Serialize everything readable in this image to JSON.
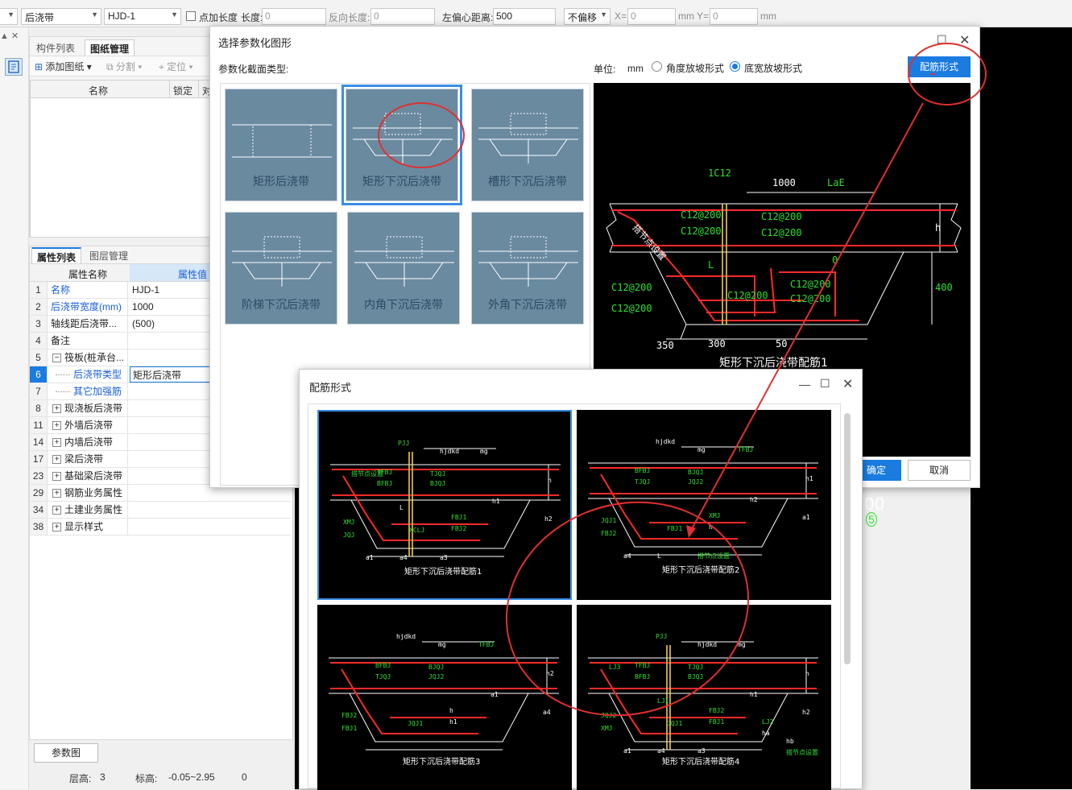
{
  "toolbar": {
    "combo1": "后浇带",
    "combo2": "HJD-1",
    "dot_length_label": "点加长度",
    "length_label": "长度:",
    "length_value": "0",
    "reverse_label": "反向长度:",
    "reverse_value": "0",
    "offset_label": "左偏心距离:",
    "offset_value": "500",
    "move_option": "不偏移",
    "x_label": "X=",
    "x_value": "0",
    "unit1": "mm",
    "y_label": "Y=",
    "y_value": "0",
    "unit2": "mm"
  },
  "left_panel": {
    "tabs": [
      "构件列表",
      "图纸管理"
    ],
    "tools": [
      "添加图纸",
      "分割",
      "定位"
    ],
    "columns": [
      "名称",
      "锁定",
      "对"
    ]
  },
  "prop_panel": {
    "tabs": [
      "属性列表",
      "图层管理"
    ],
    "headers": [
      "属性名称",
      "属性值"
    ],
    "rows": [
      {
        "num": "1",
        "name": "名称",
        "value": "HJD-1",
        "blue": true,
        "expand": false
      },
      {
        "num": "2",
        "name": "后浇带宽度(mm)",
        "value": "1000",
        "blue": true,
        "expand": false
      },
      {
        "num": "3",
        "name": "轴线距后浇带...",
        "value": "(500)",
        "blue": false,
        "expand": false
      },
      {
        "num": "4",
        "name": "备注",
        "value": "",
        "blue": false,
        "expand": false
      },
      {
        "num": "5",
        "name": "筏板(桩承台...",
        "value": "",
        "blue": false,
        "expand": true,
        "minus": true
      },
      {
        "num": "6",
        "name": "后浇带类型",
        "value": "矩形后浇带",
        "blue": true,
        "expand": false,
        "indent": true,
        "selected": true
      },
      {
        "num": "7",
        "name": "其它加强筋",
        "value": "",
        "blue": true,
        "expand": false,
        "indent": true
      },
      {
        "num": "8",
        "name": "现浇板后浇带",
        "value": "",
        "blue": false,
        "expand": true
      },
      {
        "num": "11",
        "name": "外墙后浇带",
        "value": "",
        "blue": false,
        "expand": true
      },
      {
        "num": "14",
        "name": "内墙后浇带",
        "value": "",
        "blue": false,
        "expand": true
      },
      {
        "num": "17",
        "name": "梁后浇带",
        "value": "",
        "blue": false,
        "expand": true
      },
      {
        "num": "23",
        "name": "基础梁后浇带",
        "value": "",
        "blue": false,
        "expand": true
      },
      {
        "num": "29",
        "name": "钢筋业务属性",
        "value": "",
        "blue": false,
        "expand": true
      },
      {
        "num": "34",
        "name": "土建业务属性",
        "value": "",
        "blue": false,
        "expand": true
      },
      {
        "num": "38",
        "name": "显示样式",
        "value": "",
        "blue": false,
        "expand": true
      }
    ],
    "param_button": "参数图"
  },
  "status": {
    "floor_label": "层高:",
    "floor_value": "3",
    "elev_label": "标高:",
    "elev_value": "-0.05~2.95",
    "extra": "0"
  },
  "dialog1": {
    "title": "选择参数化图形",
    "section_label": "参数化截面类型:",
    "unit_label": "单位:",
    "unit_value": "mm",
    "radio1": "角度放坡形式",
    "radio2": "底宽放坡形式",
    "rebar_button": "配筋形式",
    "thumbs": [
      "矩形后浇带",
      "矩形下沉后浇带",
      "槽形下沉后浇带",
      "阶梯下沉后浇带",
      "内角下沉后浇带",
      "外角下沉后浇带"
    ],
    "preview": {
      "title": "矩形下沉后浇带配筋1",
      "labels": {
        "c1": "1C12",
        "w": "1000",
        "lae": "LaE",
        "r1": "C12@200",
        "r2": "C12@200",
        "r3": "C12@200",
        "r4": "C12@200",
        "r5": "C12@200",
        "r6": "C12@200",
        "r7": "C12@200",
        "r8": "C12@200",
        "r9": "C12@200",
        "h": "h",
        "d400": "400",
        "L": "L",
        "d0": "0",
        "d350": "350",
        "d300": "300",
        "d50": "50",
        "node": "搭节点设置"
      }
    },
    "ok": "确定",
    "cancel": "取消"
  },
  "dialog2": {
    "title": "配筋形式",
    "items": [
      {
        "caption": "矩形下沉后浇带配筋1",
        "labels": [
          "PJJ",
          "hjdkd",
          "mg",
          "TFBJ",
          "BFBJ",
          "TJQJ",
          "BJQJ",
          "XMJ",
          "JQJ",
          "XCLJ",
          "FBJ1",
          "FBJ2",
          "h",
          "h1",
          "h2",
          "a1",
          "a4",
          "a3",
          "L",
          "搭节点设置"
        ]
      },
      {
        "caption": "矩形下沉后浇带配筋2",
        "labels": [
          "hjdkd",
          "mg",
          "TFBJ",
          "BFBJ",
          "TJQJ",
          "BJQJ",
          "JQJ2",
          "JQJ1",
          "FBJ2",
          "FBJ1",
          "XMJ",
          "h",
          "h1",
          "h2",
          "a1",
          "a4",
          "L",
          "搭节点设置"
        ]
      },
      {
        "caption": "矩形下沉后浇带配筋3",
        "labels": [
          "hjdkd",
          "mg",
          "TFBJ",
          "BFBJ",
          "TJQJ",
          "BJQJ",
          "JQJ2",
          "FBJ2",
          "FBJ1",
          "JQJ1",
          "h",
          "h1",
          "h2",
          "a1",
          "a4"
        ]
      },
      {
        "caption": "矩形下沉后浇带配筋4",
        "labels": [
          "PJJ",
          "hjdkd",
          "mg",
          "TFBJ",
          "BFBJ",
          "TJQJ",
          "BJQJ",
          "JQJ2",
          "XMJ",
          "JQJ1",
          "FBJ2",
          "FBJ1",
          "h",
          "h1",
          "h2",
          "a1",
          "a4",
          "a3",
          "LJ1",
          "LJ3",
          "LJ2",
          "ha",
          "hb",
          "搭节点设置"
        ]
      }
    ]
  },
  "canvas_text": {
    "t1": "00",
    "t2": "5"
  },
  "colors": {
    "accent": "#1a7be0",
    "annot": "#e03030",
    "rebar": "#ff2a2a",
    "dim": "#ffffff",
    "label": "#2fe02f"
  }
}
